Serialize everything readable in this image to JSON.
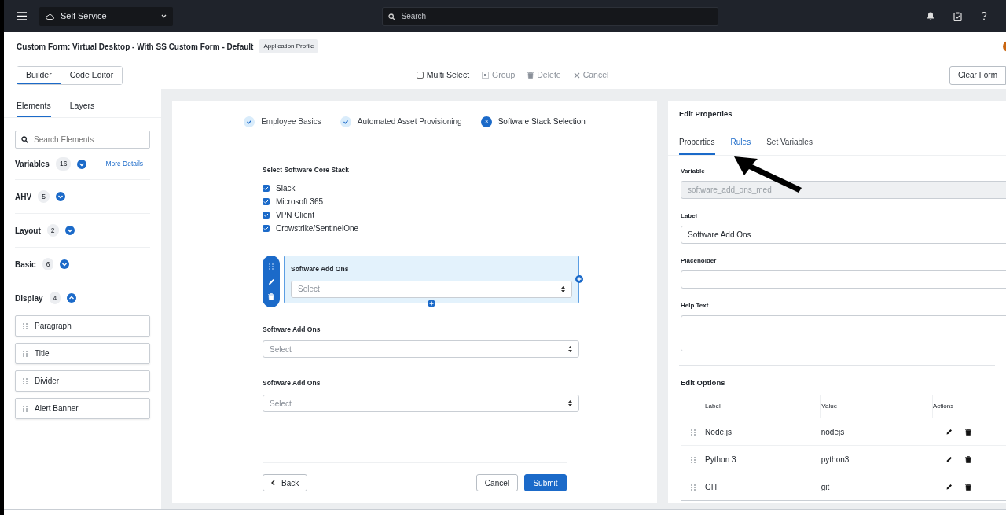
{
  "topbar": {
    "app_switcher": "Self Service",
    "search": {
      "placeholder": "Search"
    }
  },
  "header": {
    "title": "Custom Form: Virtual Desktop - With SS Custom Form - Default",
    "badge": "Application Profile"
  },
  "toolbar": {
    "view_tabs": [
      {
        "label": "Builder",
        "selected": true
      },
      {
        "label": "Code Editor",
        "selected": false
      }
    ],
    "actions": [
      {
        "kind": "checkbox",
        "label": "Multi Select",
        "checked": false,
        "disabled": false
      },
      {
        "kind": "group",
        "label": "Group",
        "disabled": true
      },
      {
        "kind": "delete",
        "label": "Delete",
        "disabled": true
      },
      {
        "kind": "cancel",
        "label": "Cancel",
        "disabled": true
      }
    ],
    "clear_button": "Clear Form"
  },
  "sidebar": {
    "tabs": [
      {
        "label": "Elements",
        "selected": true
      },
      {
        "label": "Layers",
        "selected": false
      }
    ],
    "search": {
      "placeholder": "Search Elements"
    },
    "groups": [
      {
        "label": "Variables",
        "count": "16",
        "expanded": false,
        "link": "More Details"
      },
      {
        "label": "AHV",
        "count": "5",
        "expanded": false
      },
      {
        "label": "Layout",
        "count": "2",
        "expanded": false
      },
      {
        "label": "Basic",
        "count": "6",
        "expanded": false
      },
      {
        "label": "Display",
        "count": "4",
        "expanded": true,
        "items": [
          "Paragraph",
          "Title",
          "Divider",
          "Alert Banner"
        ]
      }
    ]
  },
  "form": {
    "steps": [
      {
        "label": "Employee Basics",
        "done": true
      },
      {
        "label": "Automated Asset Provisioning",
        "done": true
      },
      {
        "label": "Software Stack Selection",
        "done": false,
        "number": "3"
      }
    ],
    "checkbox_group": {
      "label": "Select Software Core Stack",
      "options": [
        {
          "label": "Slack",
          "checked": true
        },
        {
          "label": "Microsoft 365",
          "checked": true
        },
        {
          "label": "VPN Client",
          "checked": true
        },
        {
          "label": "Crowstrike/SentinelOne",
          "checked": true
        }
      ]
    },
    "fields": [
      {
        "label": "Software Add Ons",
        "placeholder": "Select",
        "selected": true
      },
      {
        "label": "Software Add Ons",
        "placeholder": "Select",
        "selected": false
      },
      {
        "label": "Software Add Ons",
        "placeholder": "Select",
        "selected": false
      }
    ],
    "buttons": {
      "back": "Back",
      "cancel": "Cancel",
      "submit": "Submit"
    }
  },
  "properties": {
    "title": "Edit Properties",
    "tabs": [
      {
        "label": "Properties",
        "selected": true
      },
      {
        "label": "Rules",
        "selected": false
      },
      {
        "label": "Set Variables",
        "selected": false
      }
    ],
    "fields": [
      {
        "kind": "input",
        "label": "Variable",
        "value": "software_add_ons_med",
        "disabled": true
      },
      {
        "kind": "input",
        "label": "Label",
        "value": "Software Add Ons",
        "disabled": false
      },
      {
        "kind": "input",
        "label": "Placeholder",
        "disabled": false
      },
      {
        "kind": "textarea",
        "label": "Help Text",
        "disabled": false
      }
    ],
    "options": {
      "title": "Edit Options",
      "columns": [
        "Label",
        "Value",
        "Actions"
      ],
      "rows": [
        {
          "label": "Node.js",
          "value": "nodejs"
        },
        {
          "label": "Python 3",
          "value": "python3"
        },
        {
          "label": "GIT",
          "value": "git"
        }
      ]
    }
  }
}
